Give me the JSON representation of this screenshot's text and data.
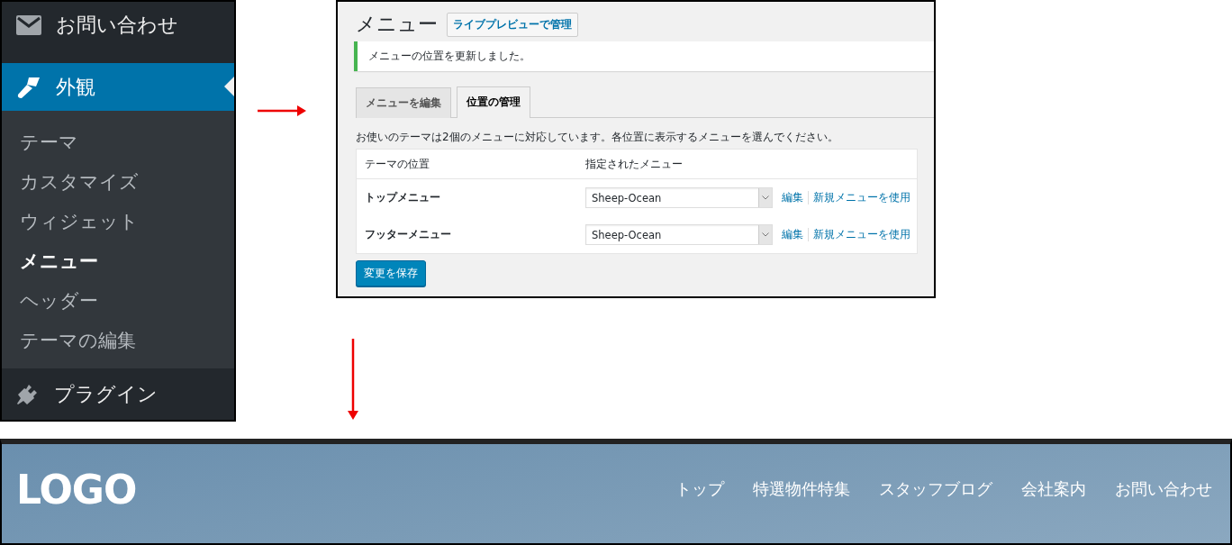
{
  "sidebar": {
    "items": [
      {
        "label": "お問い合わせ",
        "selected": false
      },
      {
        "label": "外観",
        "selected": true,
        "children": [
          {
            "label": "テーマ",
            "selected": false
          },
          {
            "label": "カスタマイズ",
            "selected": false
          },
          {
            "label": "ウィジェット",
            "selected": false
          },
          {
            "label": "メニュー",
            "selected": true
          },
          {
            "label": "ヘッダー",
            "selected": false
          },
          {
            "label": "テーマの編集",
            "selected": false
          }
        ]
      },
      {
        "label": "プラグイン",
        "selected": false
      }
    ]
  },
  "menus_screen": {
    "title": "メニュー",
    "live_preview_button": "ライブプレビューで管理",
    "notice": "メニューの位置を更新しました。",
    "tabs": [
      {
        "label": "メニューを編集",
        "selected": false
      },
      {
        "label": "位置の管理",
        "selected": true
      }
    ],
    "description": "お使いのテーマは2個のメニューに対応しています。各位置に表示するメニューを選んでください。",
    "table": {
      "columns": [
        "テーマの位置",
        "指定されたメニュー"
      ],
      "rows": [
        {
          "location": "トップメニュー",
          "menu": "Sheep-Ocean",
          "edit_link": "編集",
          "new_menu_link": "新規メニューを使用"
        },
        {
          "location": "フッターメニュー",
          "menu": "Sheep-Ocean",
          "edit_link": "編集",
          "new_menu_link": "新規メニューを使用"
        }
      ]
    },
    "save_button": "変更を保存"
  },
  "site_header": {
    "logo": "LOGO",
    "nav": [
      "トップ",
      "特選物件特集",
      "スタッフブログ",
      "会社案内",
      "お問い合わせ"
    ]
  }
}
